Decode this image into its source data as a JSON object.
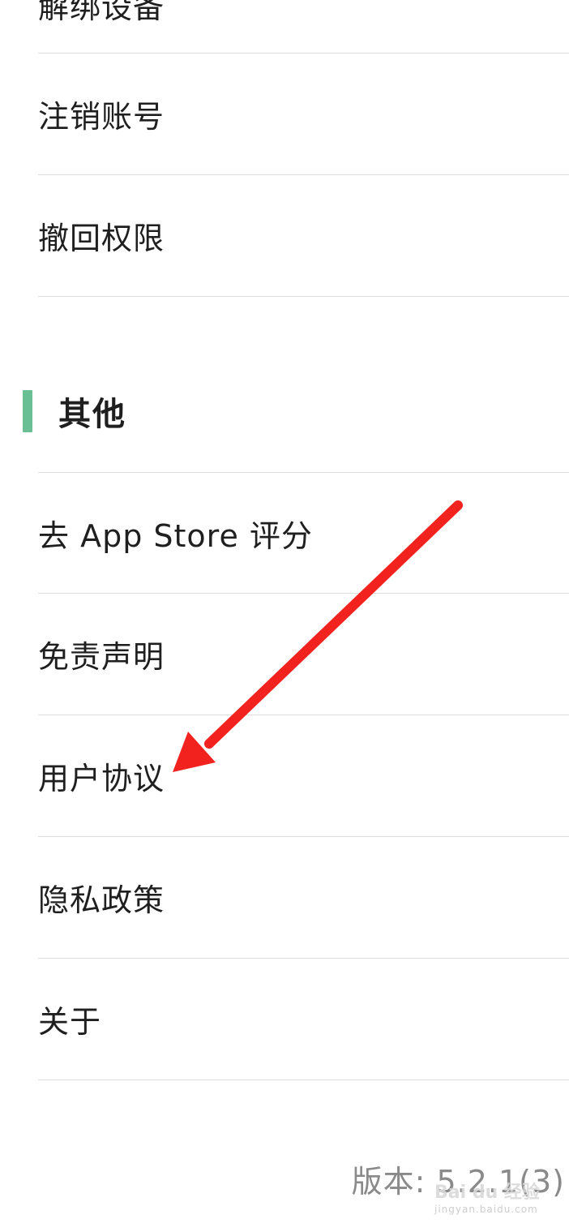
{
  "account_items": [
    {
      "label": "解绑设备"
    },
    {
      "label": "注销账号"
    },
    {
      "label": "撤回权限"
    }
  ],
  "others": {
    "title": "其他",
    "accent_color": "#6bbf95",
    "items": [
      {
        "label": "去 App Store 评分"
      },
      {
        "label": "免责声明"
      },
      {
        "label": "用户协议"
      },
      {
        "label": "隐私政策"
      },
      {
        "label": "关于"
      }
    ]
  },
  "version": "版本: 5.2.1(3)",
  "annotation_arrow": {
    "color": "#f2231f",
    "icon": "red-arrow-icon"
  },
  "watermark": {
    "brand": "Bai du 经验",
    "url": "jingyan.baidu.com"
  }
}
